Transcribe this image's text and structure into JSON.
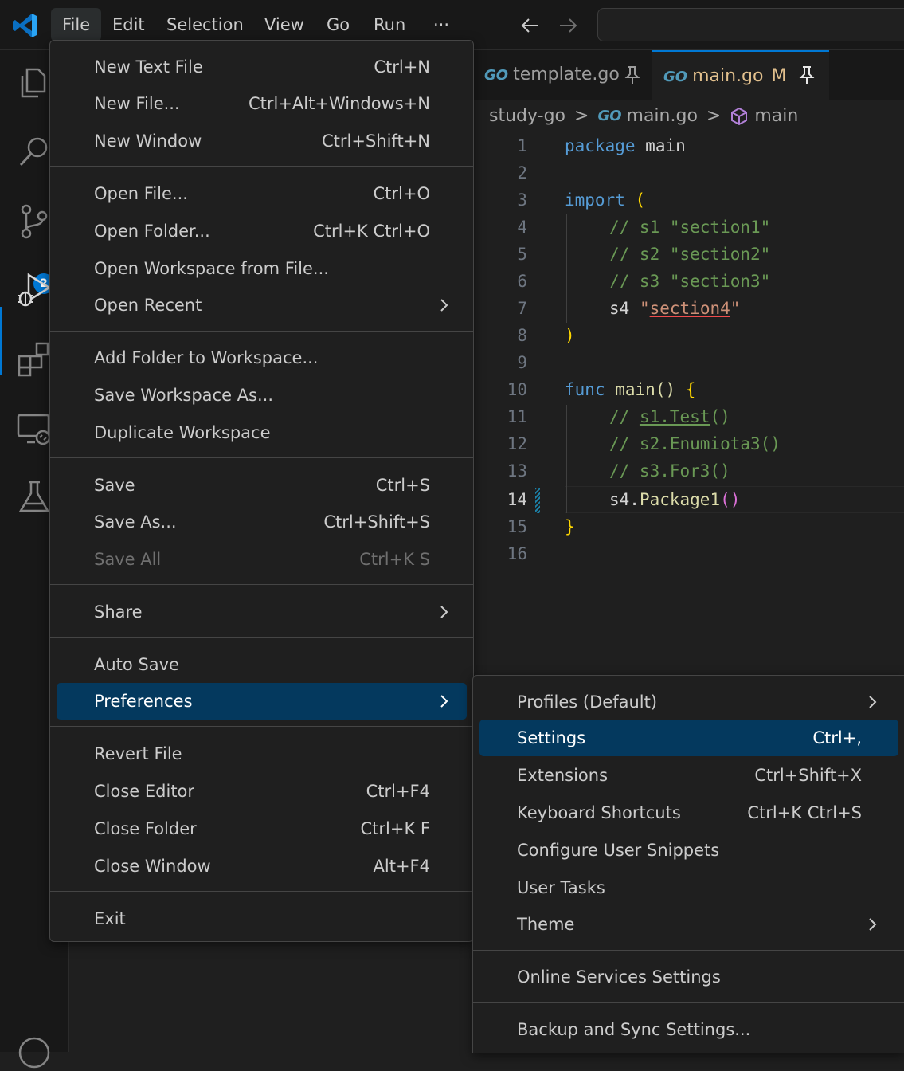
{
  "titlebar": {
    "menus": [
      "File",
      "Edit",
      "Selection",
      "View",
      "Go",
      "Run",
      "···"
    ]
  },
  "activity_bar": {
    "icons": [
      "explorer-icon",
      "search-icon",
      "source-control-icon",
      "run-debug-icon",
      "extensions-icon",
      "remote-explorer-icon",
      "testing-icon",
      "account-icon"
    ],
    "scm_badge": "2"
  },
  "tabs": [
    {
      "badge": "GO",
      "label": "template.go",
      "modified": "",
      "pinned": true
    },
    {
      "badge": "GO",
      "label": "main.go",
      "modified": "M",
      "pinned": true
    }
  ],
  "breadcrumb": {
    "folder": "study-go",
    "separator": ">",
    "file_badge": "GO",
    "file": "main.go",
    "symbol": "main"
  },
  "editor": {
    "current_line": 14,
    "lines": [
      {
        "n": "1",
        "text": "package main"
      },
      {
        "n": "2",
        "text": ""
      },
      {
        "n": "3",
        "text": "import ("
      },
      {
        "n": "4",
        "text": "    // s1 \"section1\""
      },
      {
        "n": "5",
        "text": "    // s2 \"section2\""
      },
      {
        "n": "6",
        "text": "    // s3 \"section3\""
      },
      {
        "n": "7",
        "text": "    s4 \"section4\""
      },
      {
        "n": "8",
        "text": ")"
      },
      {
        "n": "9",
        "text": ""
      },
      {
        "n": "10",
        "text": "func main() {"
      },
      {
        "n": "11",
        "text": "    // s1.Test()"
      },
      {
        "n": "12",
        "text": "    // s2.Enumiota3()"
      },
      {
        "n": "13",
        "text": "    // s3.For3()"
      },
      {
        "n": "14",
        "text": "    s4.Package1()"
      },
      {
        "n": "15",
        "text": "}"
      },
      {
        "n": "16",
        "text": ""
      }
    ],
    "tokens": {
      "l1_kw": "package",
      "l1_id": "main",
      "l3_kw": "import",
      "l3_br": "(",
      "l4": "// s1 \"section1\"",
      "l5": "// s2 \"section2\"",
      "l6": "// s3 \"section3\"",
      "l7_id": "s4",
      "l7_q1": "\"",
      "l7_str": "section4",
      "l7_q2": "\"",
      "l8_br": ")",
      "l10_kw": "func",
      "l10_fn": "main",
      "l10_p": "()",
      "l10_br": "{",
      "l11_a": "// ",
      "l11_b": "s1.Test",
      "l11_c": "()",
      "l12": "// s2.Enumiota3()",
      "l13": "// s3.For3()",
      "l14_id": "s4.",
      "l14_fn": "Package1",
      "l14_p": "()",
      "l15_br": "}"
    }
  },
  "file_menu": {
    "items": [
      {
        "label": "New Text File",
        "shortcut": "Ctrl+N"
      },
      {
        "label": "New File...",
        "shortcut": "Ctrl+Alt+Windows+N"
      },
      {
        "label": "New Window",
        "shortcut": "Ctrl+Shift+N"
      },
      {
        "label": "Open File...",
        "shortcut": "Ctrl+O"
      },
      {
        "label": "Open Folder...",
        "shortcut": "Ctrl+K Ctrl+O"
      },
      {
        "label": "Open Workspace from File...",
        "shortcut": ""
      },
      {
        "label": "Open Recent",
        "shortcut": "",
        "submenu": true
      },
      {
        "label": "Add Folder to Workspace...",
        "shortcut": ""
      },
      {
        "label": "Save Workspace As...",
        "shortcut": ""
      },
      {
        "label": "Duplicate Workspace",
        "shortcut": ""
      },
      {
        "label": "Save",
        "shortcut": "Ctrl+S"
      },
      {
        "label": "Save As...",
        "shortcut": "Ctrl+Shift+S"
      },
      {
        "label": "Save All",
        "shortcut": "Ctrl+K S",
        "disabled": true
      },
      {
        "label": "Share",
        "shortcut": "",
        "submenu": true
      },
      {
        "label": "Auto Save",
        "shortcut": ""
      },
      {
        "label": "Preferences",
        "shortcut": "",
        "submenu": true,
        "highlighted": true
      },
      {
        "label": "Revert File",
        "shortcut": ""
      },
      {
        "label": "Close Editor",
        "shortcut": "Ctrl+F4"
      },
      {
        "label": "Close Folder",
        "shortcut": "Ctrl+K F"
      },
      {
        "label": "Close Window",
        "shortcut": "Alt+F4"
      },
      {
        "label": "Exit",
        "shortcut": ""
      }
    ]
  },
  "preferences_menu": {
    "items": [
      {
        "label": "Profiles (Default)",
        "shortcut": "",
        "submenu": true
      },
      {
        "label": "Settings",
        "shortcut": "Ctrl+,",
        "highlighted": true
      },
      {
        "label": "Extensions",
        "shortcut": "Ctrl+Shift+X"
      },
      {
        "label": "Keyboard Shortcuts",
        "shortcut": "Ctrl+K Ctrl+S"
      },
      {
        "label": "Configure User Snippets",
        "shortcut": ""
      },
      {
        "label": "User Tasks",
        "shortcut": ""
      },
      {
        "label": "Theme",
        "shortcut": "",
        "submenu": true
      },
      {
        "label": "Online Services Settings",
        "shortcut": ""
      },
      {
        "label": "Backup and Sync Settings...",
        "shortcut": ""
      }
    ]
  },
  "colors": {
    "accent": "#0078d4",
    "menu_highlight": "#04395e",
    "modified_tab": "#e2c08d",
    "go_badge": "#519aba"
  }
}
